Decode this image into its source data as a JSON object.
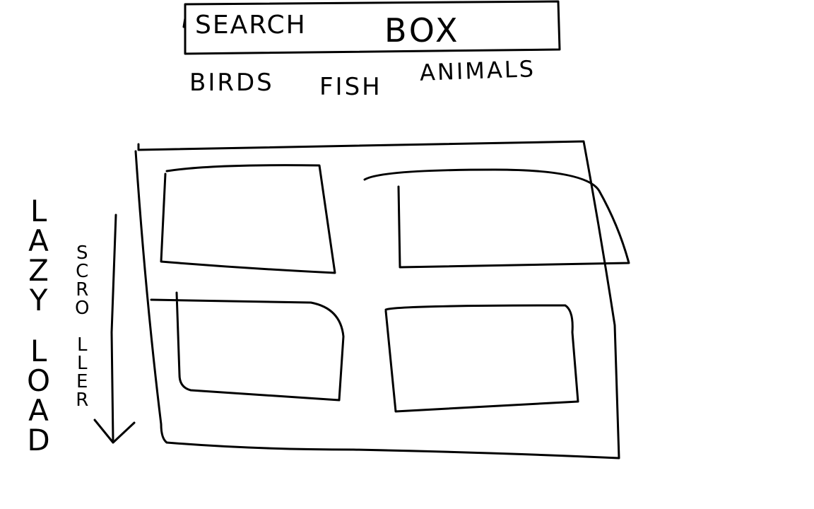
{
  "search": {
    "label_part1": "SEARCH",
    "label_part2": "BOX"
  },
  "tabs": [
    {
      "label": "BIRDS"
    },
    {
      "label": "FISH"
    },
    {
      "label": "ANIMALS"
    }
  ],
  "annotations": {
    "lazy_load_word1": [
      "L",
      "A",
      "Z",
      "Y"
    ],
    "lazy_load_word2": [
      "L",
      "O",
      "A",
      "D"
    ],
    "scroller_word": [
      "S",
      "C",
      "R",
      "O",
      "L",
      "L",
      "E",
      "R"
    ]
  },
  "grid": {
    "card_count": 4
  }
}
